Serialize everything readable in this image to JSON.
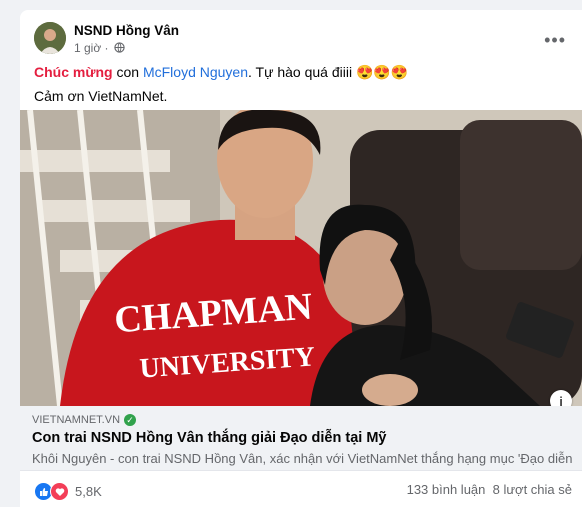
{
  "post": {
    "author": "NSND Hồng Vân",
    "time": "1 giờ ·",
    "more": "•••",
    "text": {
      "highlight": "Chúc mừng",
      "part1": " con ",
      "mention": "McFloyd Nguyen",
      "part2": ". Tự hào quá điiii 😍😍😍",
      "line2": "Cảm ơn VietNamNet."
    },
    "photo": {
      "sweater_line1": "CHAPMAN",
      "sweater_line2": "UNIVERSITY"
    },
    "info_icon": "i",
    "link": {
      "domain": "VIETNAMNET.VN",
      "verified": "✓",
      "title": "Con trai NSND Hồng Vân thắng giải Đạo diễn tại Mỹ",
      "description": "Khôi Nguyên - con trai NSND Hồng Vân, xác nhận với VietNamNet thắng hạng mục 'Đạo diễn ..."
    },
    "stats": {
      "reactions_count": "5,8K",
      "comments": "133 bình luận",
      "shares": "8 lượt chia sẻ"
    }
  },
  "colors": {
    "highlight": "#e41e3f",
    "link": "#216fdb",
    "like": "#1877f2",
    "love": "#f33e58"
  }
}
